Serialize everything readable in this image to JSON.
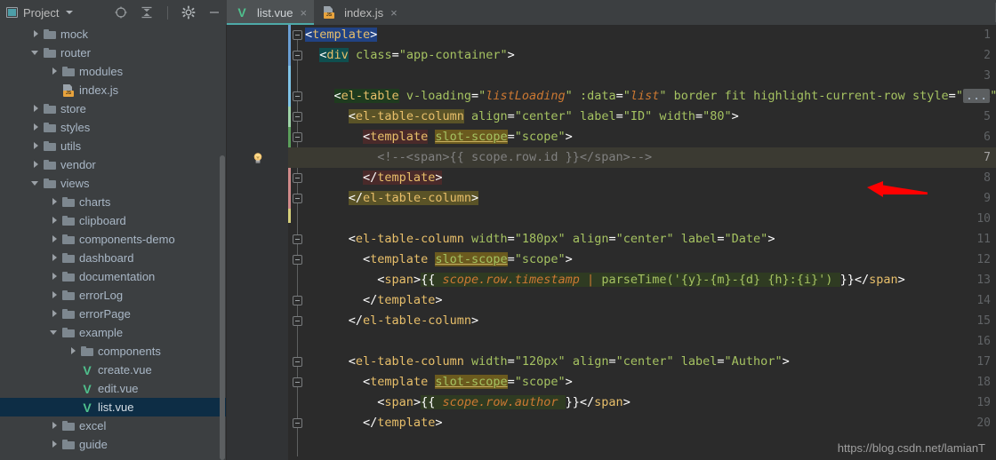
{
  "sidebar": {
    "header": {
      "title": "Project",
      "dropdown_icon": "chevron-down-icon",
      "tools": [
        {
          "name": "locate-icon",
          "label": "Select Opened File"
        },
        {
          "name": "collapse-all-icon",
          "label": "Collapse All"
        },
        {
          "name": "gear-icon",
          "label": "Settings"
        },
        {
          "name": "minimize-icon",
          "label": "Hide"
        }
      ]
    },
    "tree": [
      {
        "label": "mock",
        "indent": 1,
        "type": "folder",
        "twisty": "right",
        "selected": false
      },
      {
        "label": "router",
        "indent": 1,
        "type": "folder",
        "twisty": "down",
        "selected": false
      },
      {
        "label": "modules",
        "indent": 2,
        "type": "folder",
        "twisty": "right",
        "selected": false
      },
      {
        "label": "index.js",
        "indent": 2,
        "type": "js",
        "twisty": "none",
        "selected": false
      },
      {
        "label": "store",
        "indent": 1,
        "type": "folder",
        "twisty": "right",
        "selected": false
      },
      {
        "label": "styles",
        "indent": 1,
        "type": "folder",
        "twisty": "right",
        "selected": false
      },
      {
        "label": "utils",
        "indent": 1,
        "type": "folder",
        "twisty": "right",
        "selected": false
      },
      {
        "label": "vendor",
        "indent": 1,
        "type": "folder",
        "twisty": "right",
        "selected": false
      },
      {
        "label": "views",
        "indent": 1,
        "type": "folder",
        "twisty": "down",
        "selected": false
      },
      {
        "label": "charts",
        "indent": 2,
        "type": "folder",
        "twisty": "right",
        "selected": false
      },
      {
        "label": "clipboard",
        "indent": 2,
        "type": "folder",
        "twisty": "right",
        "selected": false
      },
      {
        "label": "components-demo",
        "indent": 2,
        "type": "folder",
        "twisty": "right",
        "selected": false
      },
      {
        "label": "dashboard",
        "indent": 2,
        "type": "folder",
        "twisty": "right",
        "selected": false
      },
      {
        "label": "documentation",
        "indent": 2,
        "type": "folder",
        "twisty": "right",
        "selected": false
      },
      {
        "label": "errorLog",
        "indent": 2,
        "type": "folder",
        "twisty": "right",
        "selected": false
      },
      {
        "label": "errorPage",
        "indent": 2,
        "type": "folder",
        "twisty": "right",
        "selected": false
      },
      {
        "label": "example",
        "indent": 2,
        "type": "folder",
        "twisty": "down",
        "selected": false
      },
      {
        "label": "components",
        "indent": 3,
        "type": "folder",
        "twisty": "right",
        "selected": false
      },
      {
        "label": "create.vue",
        "indent": 3,
        "type": "vue",
        "twisty": "none",
        "selected": false
      },
      {
        "label": "edit.vue",
        "indent": 3,
        "type": "vue",
        "twisty": "none",
        "selected": false
      },
      {
        "label": "list.vue",
        "indent": 3,
        "type": "vue",
        "twisty": "none",
        "selected": true
      },
      {
        "label": "excel",
        "indent": 2,
        "type": "folder",
        "twisty": "right",
        "selected": false
      },
      {
        "label": "guide",
        "indent": 2,
        "type": "folder",
        "twisty": "right",
        "selected": false
      }
    ],
    "scrollbar": {
      "name": "sidebar-scrollbar"
    }
  },
  "editor": {
    "tabs": [
      {
        "label": "list.vue",
        "icon": "vue-file-icon",
        "active": true,
        "close_label": "×"
      },
      {
        "label": "index.js",
        "icon": "js-file-icon",
        "active": false,
        "close_label": "×"
      }
    ],
    "current_line": 7,
    "bulb_line": 7,
    "fold_placeholder": "...",
    "line_numbers": [
      "1",
      "2",
      "3",
      "4",
      "5",
      "6",
      "7",
      "8",
      "9",
      "10",
      "11",
      "12",
      "13",
      "14",
      "15",
      "16",
      "17",
      "18",
      "19",
      "20"
    ],
    "lines": [
      {
        "n": 1,
        "text": "<template>"
      },
      {
        "n": 2,
        "text": "  <div class=\"app-container\">"
      },
      {
        "n": 3,
        "text": ""
      },
      {
        "n": 4,
        "text": "    <el-table v-loading=\"listLoading\" :data=\"list\" border fit highlight-current-row style=\"...\">"
      },
      {
        "n": 5,
        "text": "      <el-table-column align=\"center\" label=\"ID\" width=\"80\">"
      },
      {
        "n": 6,
        "text": "        <template slot-scope=\"scope\">"
      },
      {
        "n": 7,
        "text": "          <!--<span>{{ scope.row.id }}</span>-->"
      },
      {
        "n": 8,
        "text": "        </template>"
      },
      {
        "n": 9,
        "text": "      </el-table-column>"
      },
      {
        "n": 10,
        "text": ""
      },
      {
        "n": 11,
        "text": "      <el-table-column width=\"180px\" align=\"center\" label=\"Date\">"
      },
      {
        "n": 12,
        "text": "        <template slot-scope=\"scope\">"
      },
      {
        "n": 13,
        "text": "          <span>{{ scope.row.timestamp | parseTime('{y}-{m}-{d} {h}:{i}') }}</span>"
      },
      {
        "n": 14,
        "text": "        </template>"
      },
      {
        "n": 15,
        "text": "      </el-table-column>"
      },
      {
        "n": 16,
        "text": ""
      },
      {
        "n": 17,
        "text": "      <el-table-column width=\"120px\" align=\"center\" label=\"Author\">"
      },
      {
        "n": 18,
        "text": "        <template slot-scope=\"scope\">"
      },
      {
        "n": 19,
        "text": "          <span>{{ scope.row.author }}</span>"
      },
      {
        "n": 20,
        "text": "        </template>"
      }
    ],
    "annotation": {
      "name": "red-arrow-annotation",
      "points_to_line": 7,
      "color": "#ff0000"
    }
  },
  "watermark": {
    "text": "https://blog.csdn.net/lamianT"
  },
  "colors": {
    "sidebar_bg": "#3c3f41",
    "editor_bg": "#2b2b2b",
    "gutter_bg": "#313335",
    "selection_bg": "#0d2d45",
    "tab_active_bg": "#4e5254",
    "tab_underline": "#4eaaa8",
    "vue_green": "#4fc08d",
    "js_yellow": "#e8a33d",
    "current_line_bg": "#3b3a32",
    "accent_red": "#ff0000"
  }
}
